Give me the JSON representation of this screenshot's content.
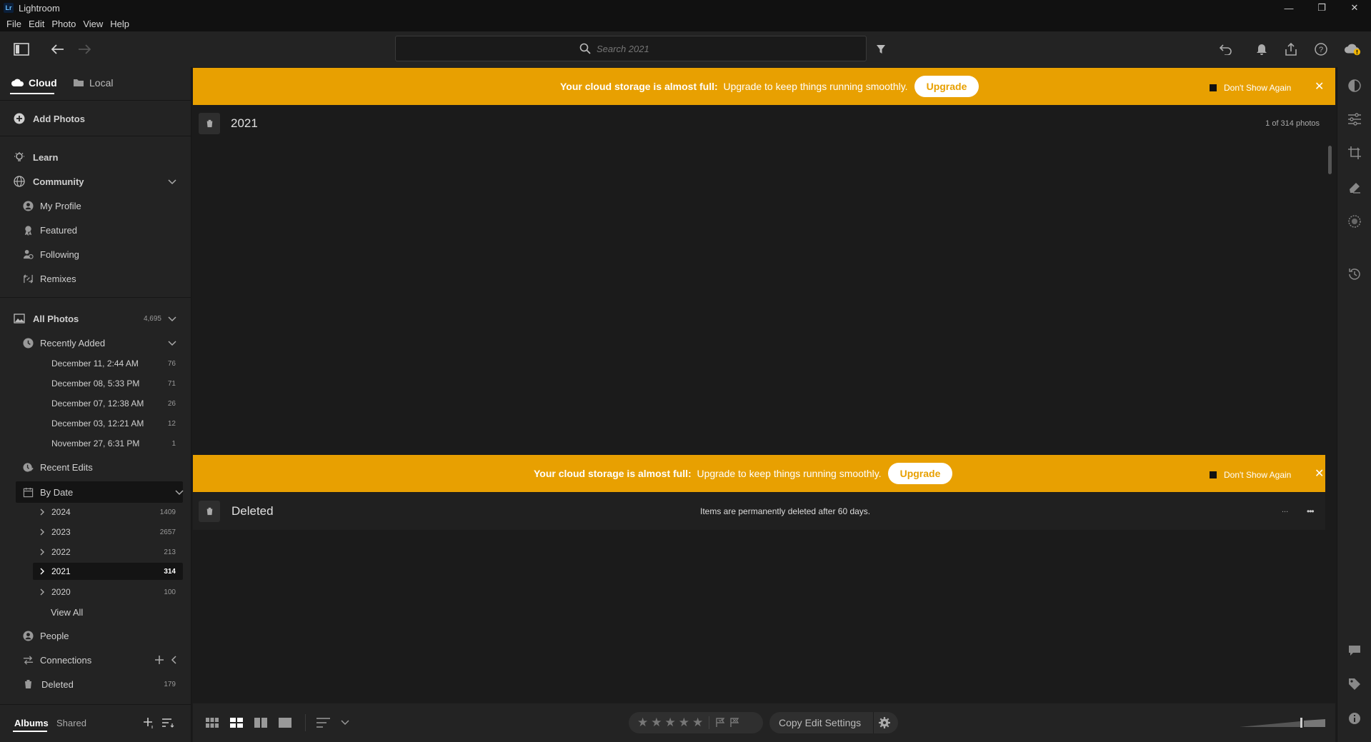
{
  "app": {
    "logo": "Lr",
    "title": "Lightroom"
  },
  "window_controls": {
    "minimize": "—",
    "restore": "❐",
    "close": "✕"
  },
  "menu": [
    "File",
    "Edit",
    "Photo",
    "View",
    "Help"
  ],
  "search": {
    "placeholder": "Search 2021"
  },
  "sidebar": {
    "tabs": {
      "cloud": "Cloud",
      "local": "Local"
    },
    "add_photos": "Add Photos",
    "learn": "Learn",
    "community": {
      "label": "Community",
      "items": [
        "My Profile",
        "Featured",
        "Following",
        "Remixes"
      ]
    },
    "all_photos": {
      "label": "All Photos",
      "count": "4,695"
    },
    "recently_added": {
      "label": "Recently Added",
      "items": [
        {
          "label": "December 11, 2:44 AM",
          "count": "76"
        },
        {
          "label": "December 08, 5:33 PM",
          "count": "71"
        },
        {
          "label": "December 07, 12:38 AM",
          "count": "26"
        },
        {
          "label": "December 03, 12:21 AM",
          "count": "12"
        },
        {
          "label": "November 27, 6:31 PM",
          "count": "1"
        }
      ]
    },
    "recent_edits": "Recent Edits",
    "by_date": {
      "label": "By Date",
      "years": [
        {
          "label": "2024",
          "count": "1409"
        },
        {
          "label": "2023",
          "count": "2657"
        },
        {
          "label": "2022",
          "count": "213"
        },
        {
          "label": "2021",
          "count": "314"
        },
        {
          "label": "2020",
          "count": "100"
        }
      ],
      "view_all": "View All"
    },
    "people": "People",
    "connections": "Connections",
    "deleted": {
      "label": "Deleted",
      "count": "179"
    },
    "bottom_tabs": {
      "albums": "Albums",
      "shared": "Shared"
    }
  },
  "banner": {
    "bold": "Your cloud storage is almost full:",
    "text": "Upgrade to keep things running smoothly.",
    "button": "Upgrade",
    "dont_show": "Don't Show Again",
    "close": "✕"
  },
  "section_2021": {
    "title": "2021",
    "count": "1 of 314 photos"
  },
  "section_deleted": {
    "title": "Deleted",
    "note": "Items are permanently deleted after 60 days.",
    "small_dots": "...",
    "more": "•••"
  },
  "bottombar": {
    "stars": [
      "★",
      "★",
      "★",
      "★",
      "★"
    ],
    "copy_edit": "Copy Edit Settings"
  },
  "colors": {
    "accent_banner": "#e8a001",
    "background": "#1b1b1b",
    "panel": "#232323"
  }
}
